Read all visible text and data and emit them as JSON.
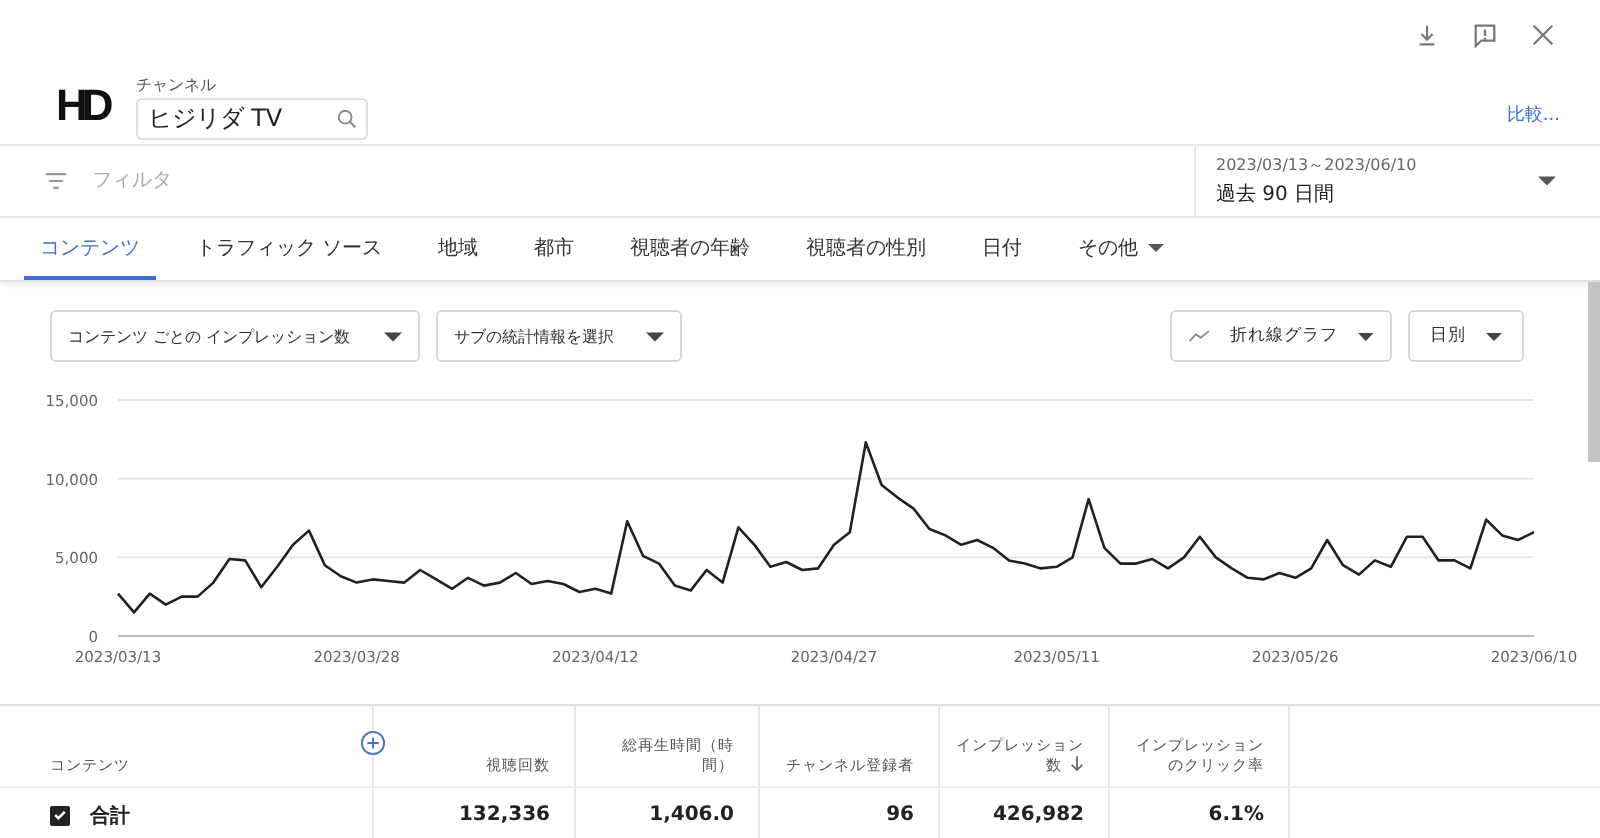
{
  "header": {
    "logo_text": "HD",
    "channel_label": "チャンネル",
    "channel_value": "ヒジリダ TV",
    "compare_link": "比較..."
  },
  "filter": {
    "placeholder": "フィルタ"
  },
  "date_range": {
    "range": "2023/03/13～2023/06/10",
    "label": "過去 90 日間"
  },
  "tabs": [
    {
      "label": "コンテンツ",
      "selected": true,
      "dropdown": false
    },
    {
      "label": "トラフィック ソース",
      "selected": false,
      "dropdown": false
    },
    {
      "label": "地域",
      "selected": false,
      "dropdown": false
    },
    {
      "label": "都市",
      "selected": false,
      "dropdown": false
    },
    {
      "label": "視聴者の年齢",
      "selected": false,
      "dropdown": false
    },
    {
      "label": "視聴者の性別",
      "selected": false,
      "dropdown": false
    },
    {
      "label": "日付",
      "selected": false,
      "dropdown": false
    },
    {
      "label": "その他",
      "selected": false,
      "dropdown": true
    }
  ],
  "controls": [
    {
      "kind": "metric",
      "label": "コンテンツ ごとの インプレッション数"
    },
    {
      "kind": "metric",
      "label": "サブの統計情報を選択"
    },
    {
      "kind": "chart_type",
      "label": "折れ線グラフ"
    },
    {
      "kind": "period",
      "label": "日別"
    }
  ],
  "chart_data": {
    "type": "line",
    "categories": [
      "2023/03/13",
      null,
      null,
      null,
      null,
      null,
      null,
      null,
      null,
      null,
      null,
      null,
      null,
      null,
      null,
      "2023/03/28",
      null,
      null,
      null,
      null,
      null,
      null,
      null,
      null,
      null,
      null,
      null,
      null,
      null,
      null,
      "2023/04/12",
      null,
      null,
      null,
      null,
      null,
      null,
      null,
      null,
      null,
      null,
      null,
      null,
      null,
      null,
      "2023/04/27",
      null,
      null,
      null,
      null,
      null,
      null,
      null,
      null,
      null,
      null,
      null,
      null,
      null,
      "2023/05/11",
      null,
      null,
      null,
      null,
      null,
      null,
      null,
      null,
      null,
      null,
      null,
      null,
      null,
      null,
      "2023/05/26",
      null,
      null,
      null,
      null,
      null,
      null,
      null,
      null,
      null,
      null,
      null,
      null,
      null,
      null,
      "2023/06/10"
    ],
    "series": [
      {
        "color": "#212121",
        "values": [
          2700,
          1500,
          2700,
          2000,
          2500,
          2500,
          3400,
          4900,
          4800,
          3100,
          4400,
          5800,
          6700,
          4500,
          3800,
          3400,
          3600,
          3500,
          3400,
          4200,
          3600,
          3000,
          3700,
          3200,
          3400,
          4000,
          3300,
          3500,
          3300,
          2800,
          3000,
          2700,
          7300,
          5100,
          4600,
          3200,
          2900,
          4200,
          3400,
          6900,
          5800,
          4400,
          4700,
          4200,
          4300,
          5800,
          6600,
          12300,
          9600,
          8800,
          8100,
          6800,
          6400,
          5800,
          6100,
          5600,
          4800,
          4600,
          4300,
          4400,
          5000,
          8700,
          5600,
          4600,
          4600,
          4900,
          4300,
          5000,
          6300,
          5000,
          4300,
          3700,
          3600,
          4000,
          3700,
          4300,
          6100,
          4500,
          3900,
          4800,
          4400,
          6300,
          6300,
          4800,
          4800,
          4300,
          7400,
          6400,
          6100,
          6600
        ]
      }
    ],
    "ylim": [
      0,
      15000
    ],
    "yticks": [
      {
        "value": 0,
        "label": "0"
      },
      {
        "value": 5000,
        "label": "5,000"
      },
      {
        "value": 10000,
        "label": "10,000"
      },
      {
        "value": 15000,
        "label": "15,000"
      }
    ]
  },
  "table": {
    "columns": [
      {
        "label": "コンテンツ",
        "sorted_descending": false
      },
      {
        "label": "視聴回数",
        "sorted_descending": false
      },
      {
        "label": "総再生時間（時間）",
        "sorted_descending": false
      },
      {
        "label": "チャンネル登録者",
        "sorted_descending": false
      },
      {
        "label": "インプレッション数",
        "sorted_descending": true
      },
      {
        "label": "インプレッションのクリック率",
        "sorted_descending": false
      }
    ],
    "rows": [
      {
        "checked": true,
        "cells": [
          "合計",
          "132,336",
          "1,406.0",
          "96",
          "426,982",
          "6.1%"
        ]
      }
    ]
  }
}
